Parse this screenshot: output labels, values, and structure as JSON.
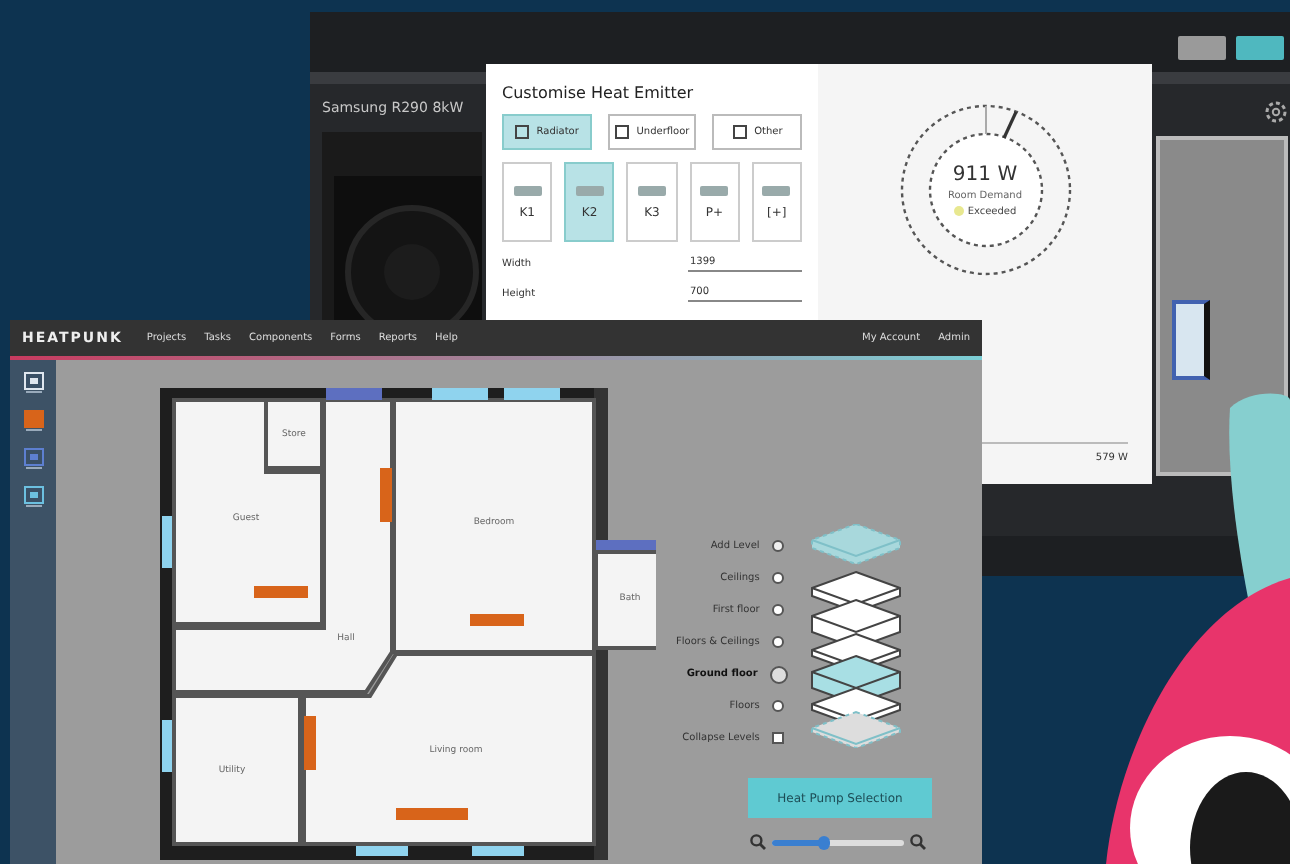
{
  "back_window": {
    "heat_pump": "Samsung R290 8kW"
  },
  "modal": {
    "title": "Customise Heat Emitter",
    "emitter_types": [
      {
        "label": "Radiator",
        "selected": true
      },
      {
        "label": "Underfloor",
        "selected": false
      },
      {
        "label": "Other",
        "selected": false
      }
    ],
    "models": [
      {
        "code": "K1",
        "selected": false
      },
      {
        "code": "K2",
        "selected": true
      },
      {
        "code": "K3",
        "selected": false
      },
      {
        "code": "P+",
        "selected": false
      },
      {
        "code": "[+]",
        "selected": false
      }
    ],
    "fields": [
      {
        "label": "Width",
        "value": "1399"
      },
      {
        "label": "Height",
        "value": "700"
      }
    ],
    "gauge": {
      "value": "911 W",
      "caption": "Room Demand",
      "status": "Exceeded"
    },
    "total": "579 W"
  },
  "app": {
    "brand": "HEATPUNK",
    "nav": [
      "Projects",
      "Tasks",
      "Components",
      "Forms",
      "Reports",
      "Help"
    ],
    "account_menu": [
      "My Account",
      "Admin"
    ],
    "tools": [
      {
        "selected": false
      },
      {
        "selected": true
      },
      {
        "selected": false
      },
      {
        "selected": false
      }
    ]
  },
  "floor_plan": {
    "rooms": [
      {
        "name": "Store"
      },
      {
        "name": "Guest"
      },
      {
        "name": "Bedroom"
      },
      {
        "name": "Bath"
      },
      {
        "name": "Hall"
      },
      {
        "name": "Utility"
      },
      {
        "name": "Living room"
      }
    ]
  },
  "levels": [
    {
      "label": "Add Level",
      "kind": "add",
      "selected": false
    },
    {
      "label": "Ceilings",
      "kind": "level",
      "selected": false
    },
    {
      "label": "First floor",
      "kind": "level",
      "selected": false
    },
    {
      "label": "Floors & Ceilings",
      "kind": "level",
      "selected": false
    },
    {
      "label": "Ground floor",
      "kind": "level",
      "selected": true
    },
    {
      "label": "Floors",
      "kind": "level",
      "selected": false
    },
    {
      "label": "Collapse Levels",
      "kind": "collapse",
      "selected": false
    }
  ],
  "action_button": "Heat Pump Selection",
  "zoom": {
    "level": 0.4
  }
}
